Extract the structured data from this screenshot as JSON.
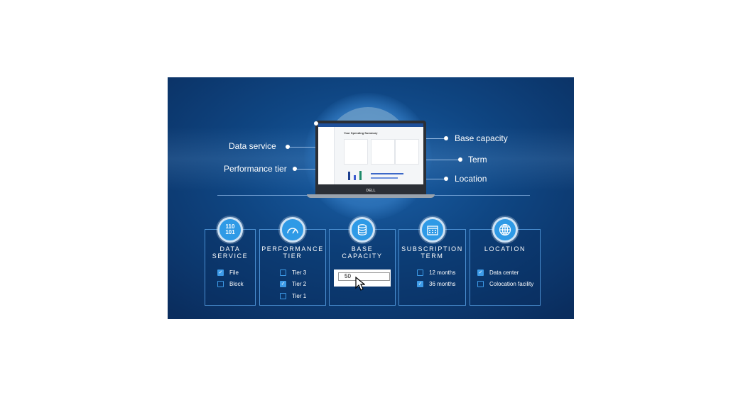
{
  "callouts": {
    "left": [
      "Data service",
      "Performance tier"
    ],
    "right": [
      "Base capacity",
      "Term",
      "Location"
    ]
  },
  "laptop": {
    "screen_title": "Your Spending Summary",
    "brand": "DELL"
  },
  "cards": [
    {
      "title1": "DATA",
      "title2": "SERVICE",
      "icon": "binary-icon",
      "icon_text": "110\n101",
      "options": [
        {
          "label": "File",
          "checked": true
        },
        {
          "label": "Block",
          "checked": false
        }
      ]
    },
    {
      "title1": "PERFORMANCE",
      "title2": "TIER",
      "icon": "speedometer-icon",
      "options": [
        {
          "label": "Tier 3",
          "checked": false
        },
        {
          "label": "Tier 2",
          "checked": true
        },
        {
          "label": "Tier 1",
          "checked": false
        }
      ]
    },
    {
      "title1": "BASE",
      "title2": "CAPACITY",
      "icon": "database-icon",
      "input_value": "50"
    },
    {
      "title1": "SUBSCRIPTION",
      "title2": "TERM",
      "icon": "calendar-icon",
      "options": [
        {
          "label": "12 months",
          "checked": false
        },
        {
          "label": "36 months",
          "checked": true
        }
      ]
    },
    {
      "title1": "LOCATION",
      "title2": "",
      "icon": "globe-icon",
      "options": [
        {
          "label": "Data center",
          "checked": true
        },
        {
          "label": "Colocation facility",
          "checked": false
        }
      ]
    }
  ],
  "colors": {
    "background": "#0a2d5e",
    "accent": "#2f9ae6",
    "card_border": "#4a8ed0"
  }
}
